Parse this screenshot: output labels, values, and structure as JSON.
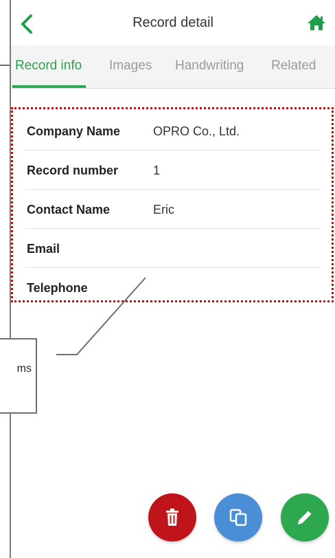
{
  "header": {
    "title": "Record detail",
    "back_icon": "chevron-left-icon",
    "home_icon": "home-icon",
    "accent": "#1e9e46"
  },
  "tabs": [
    {
      "label": "Record info",
      "active": true
    },
    {
      "label": "Images",
      "active": false
    },
    {
      "label": "Handwriting",
      "active": false
    },
    {
      "label": "Related",
      "active": false
    }
  ],
  "record": {
    "rows": [
      {
        "label": "Company Name",
        "value": "OPRO Co., Ltd."
      },
      {
        "label": "Record number",
        "value": "1"
      },
      {
        "label": "Contact Name",
        "value": "Eric"
      },
      {
        "label": "Email",
        "value": ""
      },
      {
        "label": "Telephone",
        "value": ""
      }
    ]
  },
  "callout": {
    "text_fragment": "ms"
  },
  "actions": {
    "delete_icon": "trash-icon",
    "copy_icon": "copy-icon",
    "edit_icon": "pencil-icon",
    "delete_color": "#c0141b",
    "copy_color": "#4a8fd6",
    "edit_color": "#2ea84f"
  }
}
